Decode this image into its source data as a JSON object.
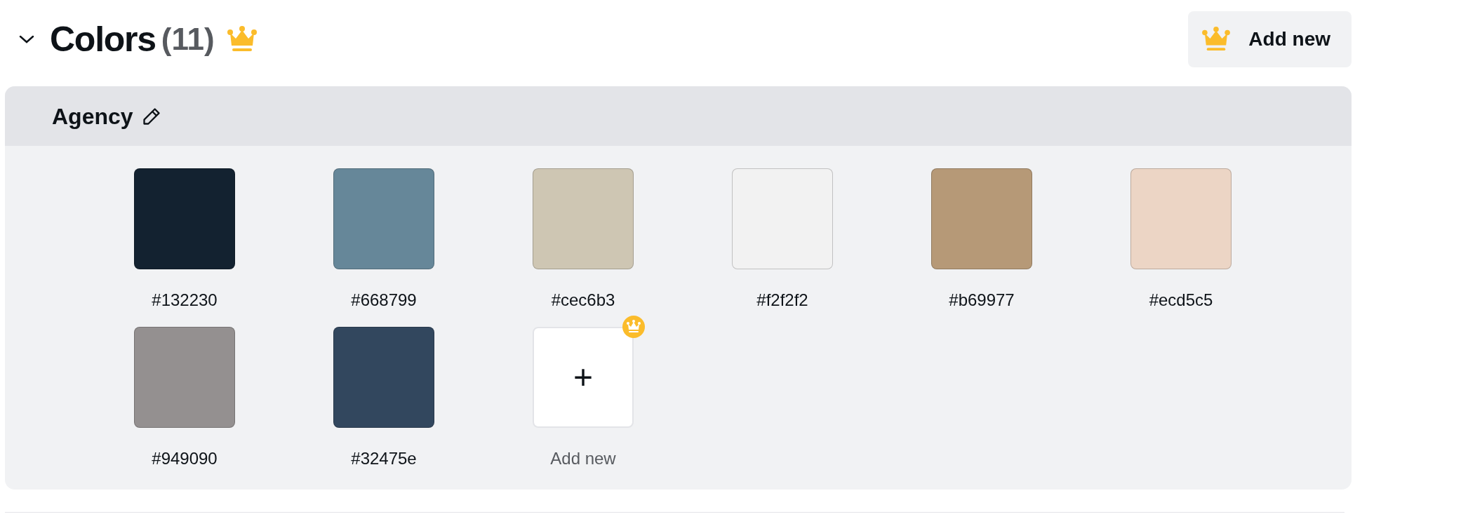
{
  "section": {
    "title": "Colors",
    "count": "(11)",
    "expanded": true,
    "add_button": "Add new"
  },
  "palette": {
    "name": "Agency",
    "colors": [
      {
        "label": "#132230",
        "color": "#132230"
      },
      {
        "label": "#668799",
        "color": "#668799"
      },
      {
        "label": "#cec6b3",
        "color": "#cec6b3"
      },
      {
        "label": "#f2f2f2",
        "color": "#f2f2f2"
      },
      {
        "label": "#b69977",
        "color": "#b69977"
      },
      {
        "label": "#ecd5c5",
        "color": "#ecd5c5"
      },
      {
        "label": "#949090",
        "color": "#949090"
      },
      {
        "label": "#32475e",
        "color": "#32475e"
      }
    ],
    "add_tile": {
      "label": "Add new",
      "plus": "+"
    }
  }
}
